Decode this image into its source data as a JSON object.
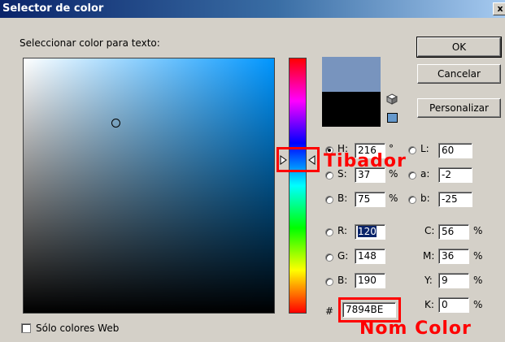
{
  "window": {
    "title": "Selector de color",
    "close_label": "x"
  },
  "prompt": "Seleccionar color para texto:",
  "buttons": {
    "ok": "OK",
    "cancel": "Cancelar",
    "custom": "Personalizar"
  },
  "colors": {
    "new": "#7894be",
    "old": "#000000",
    "websafe": "#6699cc",
    "annotation": "#ff0000"
  },
  "hsb": {
    "h": {
      "label": "H:",
      "value": "216",
      "unit": "°"
    },
    "s": {
      "label": "S:",
      "value": "37",
      "unit": "%"
    },
    "b": {
      "label": "B:",
      "value": "75",
      "unit": "%"
    }
  },
  "lab": {
    "l": {
      "label": "L:",
      "value": "60"
    },
    "a": {
      "label": "a:",
      "value": "-2"
    },
    "b": {
      "label": "b:",
      "value": "-25"
    }
  },
  "rgb": {
    "r": {
      "label": "R:",
      "value": "120"
    },
    "g": {
      "label": "G:",
      "value": "148"
    },
    "b": {
      "label": "B:",
      "value": "190"
    }
  },
  "cmyk": {
    "c": {
      "label": "C:",
      "value": "56",
      "unit": "%"
    },
    "m": {
      "label": "M:",
      "value": "36",
      "unit": "%"
    },
    "y": {
      "label": "Y:",
      "value": "9",
      "unit": "%"
    },
    "k": {
      "label": "K:",
      "value": "0",
      "unit": "%"
    }
  },
  "hex": {
    "prefix": "#",
    "value": "7894BE"
  },
  "web_only": {
    "label": "Sólo colores Web",
    "checked": false
  },
  "annotations": {
    "slider": "Tibador",
    "color_name": "Nom Color"
  },
  "icons": {
    "gamut_warning": "cube-icon",
    "websafe_swatch": "swatch-icon"
  }
}
